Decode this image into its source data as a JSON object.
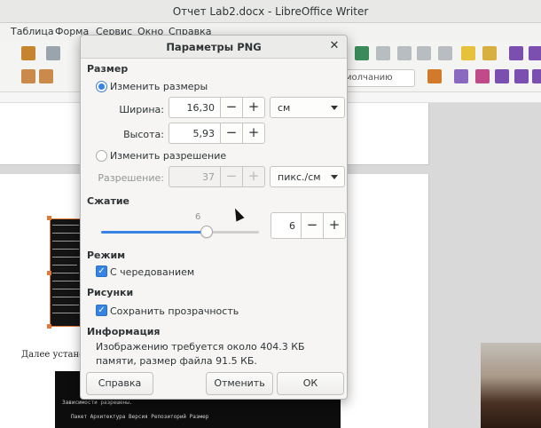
{
  "window": {
    "title": "Отчет Lab2.docx - LibreOffice Writer",
    "menu": [
      "Таблица",
      "Форма",
      "Сервис",
      "Окно",
      "Справка"
    ],
    "style_combo": "молчанию"
  },
  "document": {
    "text_fragment": "Далее установ",
    "terminal_rows": [
      "[dlatinp...",
      "[dlatinp...",
      "rvanderdo...",
      "[dlatinp...",
      "[dlatinp...",
      "[sudo] на...",
      "=== git...",
      "Installin...",
      "Cloning i...",
      "Клонирова...",
      "remote: E...",
      "Получение..."
    ],
    "terminal2_rows": [
      "Зависимости разрешены.",
      "Пакет          Архитектура      Версия         Репозиторий       Размер"
    ]
  },
  "dialog": {
    "title": "Параметры PNG",
    "close_icon": "close-icon",
    "size": {
      "section": "Размер",
      "resize_option": "Изменить размеры",
      "width_label": "Ширина:",
      "width_value": "16,30",
      "height_label": "Высота:",
      "height_value": "5,93",
      "unit": "см",
      "resolution_option": "Изменить разрешение",
      "resolution_label": "Разрешение:",
      "resolution_value": "37",
      "resolution_unit": "пикс./см",
      "minus": "−",
      "plus": "+"
    },
    "compression": {
      "section": "Сжатие",
      "slider_label": "6",
      "value": "6",
      "level_fraction": 0.6667,
      "minus": "−",
      "plus": "+"
    },
    "mode": {
      "section": "Режим",
      "interlaced_label": "С чередованием",
      "interlaced_checked": true
    },
    "images": {
      "section": "Рисунки",
      "transparency_label": "Сохранить прозрачность",
      "transparency_checked": true
    },
    "info": {
      "section": "Информация",
      "text": "Изображению требуется около 404.3 КБ памяти, размер файла 91.5 КБ."
    },
    "buttons": {
      "help": "Справка",
      "cancel": "Отменить",
      "ok": "ОК"
    }
  }
}
